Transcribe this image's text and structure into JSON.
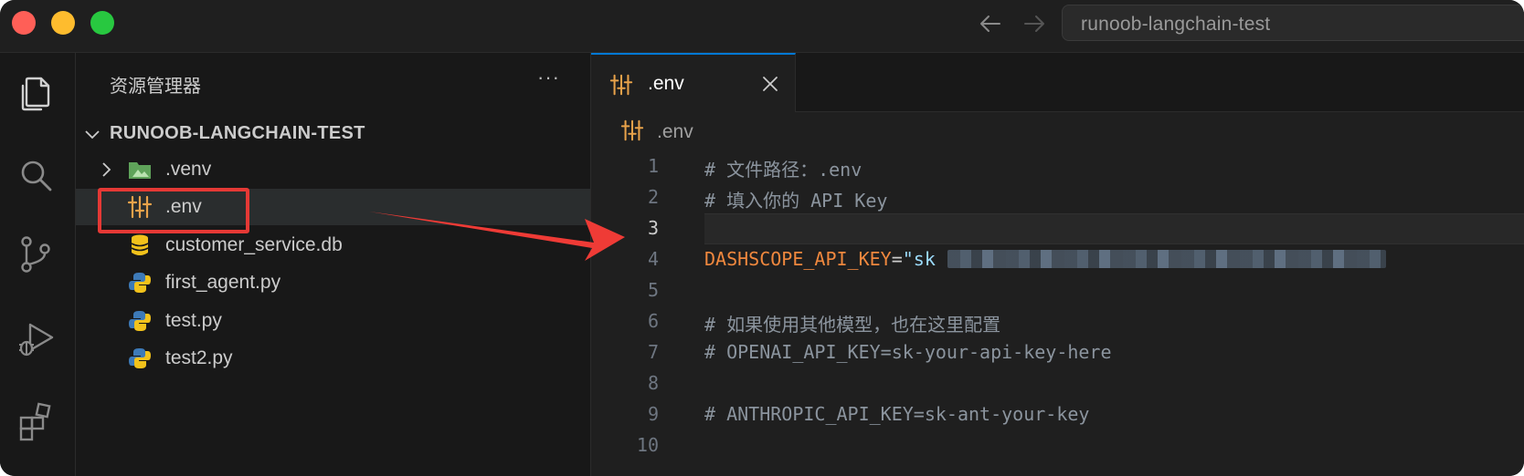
{
  "window": {
    "title_search": "runoob-langchain-test",
    "traffic_lights": {
      "close": "#ff5f57",
      "minimize": "#febc2e",
      "zoom": "#28c840"
    }
  },
  "activity_bar": {
    "items": [
      {
        "icon": "files-icon"
      },
      {
        "icon": "search-icon"
      },
      {
        "icon": "source-control-icon"
      },
      {
        "icon": "run-debug-icon"
      },
      {
        "icon": "extensions-icon"
      }
    ]
  },
  "sidebar": {
    "title": "资源管理器",
    "more": "···",
    "folder": "RUNOOB-LANGCHAIN-TEST",
    "files": [
      {
        "name": ".venv",
        "icon": "folder-icon"
      },
      {
        "name": ".env",
        "icon": "env-settings-icon"
      },
      {
        "name": "customer_service.db",
        "icon": "database-icon"
      },
      {
        "name": "first_agent.py",
        "icon": "python-icon"
      },
      {
        "name": "test.py",
        "icon": "python-icon"
      },
      {
        "name": "test2.py",
        "icon": "python-icon"
      }
    ]
  },
  "editor": {
    "tab_label": ".env",
    "breadcrumb": ".env",
    "current_line": 3,
    "lines": [
      {
        "n": "1",
        "text": "# 文件路径：.env"
      },
      {
        "n": "2",
        "text": "# 填入你的 API Key"
      },
      {
        "n": "3",
        "text": ""
      },
      {
        "n": "4",
        "key": "DASHSCOPE_API_KEY",
        "op": "=",
        "str": "\"sk"
      },
      {
        "n": "5",
        "text": ""
      },
      {
        "n": "6",
        "text": "# 如果使用其他模型，也在这里配置"
      },
      {
        "n": "7",
        "text": "# OPENAI_API_KEY=sk-your-api-key-here"
      },
      {
        "n": "8",
        "text": ""
      },
      {
        "n": "9",
        "text": "# ANTHROPIC_API_KEY=sk-ant-your-key"
      },
      {
        "n": "10",
        "text": ""
      }
    ]
  },
  "colors": {
    "accent": "#0078d4",
    "highlight_box": "#e53935",
    "env_icon": "#e8a24a",
    "key": "#f0883e",
    "string": "#9cdcfe",
    "comment": "#8b949e"
  }
}
